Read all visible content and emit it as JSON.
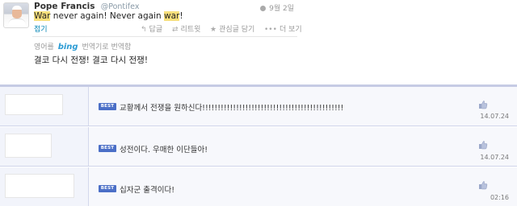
{
  "tweet": {
    "author_name": "Pope Francis",
    "author_handle": "@Pontifex",
    "time": "9월 2일",
    "text_parts": [
      "War",
      " never again! Never again ",
      "war",
      "!"
    ],
    "expand_label": "접기",
    "actions": [
      {
        "icon": "reply-icon",
        "glyph": "↰",
        "label": "답글"
      },
      {
        "icon": "retweet-icon",
        "glyph": "⇄",
        "label": "리트윗"
      },
      {
        "icon": "favorite-icon",
        "glyph": "★",
        "label": "관심글 담기"
      },
      {
        "icon": "more-icon",
        "glyph": "•••",
        "label": "더 보기"
      }
    ],
    "translate_prefix": "영어를",
    "translate_brand": "bing",
    "translate_suffix": "번역기로 번역함",
    "translated_text": "결코 다시 전쟁! 결코 다시 전쟁!"
  },
  "comments": [
    {
      "badge": "BEST",
      "text": "교황께서 전쟁을 원하신다!!!!!!!!!!!!!!!!!!!!!!!!!!!!!!!!!!!!!!!!!!!!!!",
      "date": "14.07.24",
      "like_icon": "thumbs-up-icon"
    },
    {
      "badge": "BEST",
      "text": "성전이다. 우매한 이단들아!",
      "date": "14.07.24",
      "like_icon": "thumbs-up-icon"
    },
    {
      "badge": "BEST",
      "text": "십자군 출격이다!",
      "date": "02:16",
      "like_icon": "thumbs-up-icon"
    }
  ],
  "colors": {
    "highlight": "#f8e07c",
    "best_badge": "#4b6fc7",
    "link": "#0084b4",
    "bing": "#2b9bd4"
  }
}
